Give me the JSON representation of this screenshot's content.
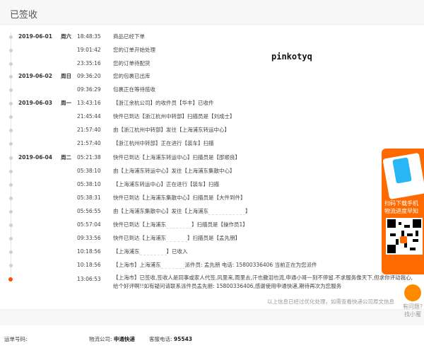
{
  "header": {
    "title": "已签收"
  },
  "watermark": "pinkotyq",
  "timeline": [
    {
      "date": "2019-06-01",
      "weekday": "周六",
      "time": "18:48:35",
      "desc": "商品已经下单"
    },
    {
      "date": "",
      "weekday": "",
      "time": "19:01:42",
      "desc": "您的订单开始处理"
    },
    {
      "date": "",
      "weekday": "",
      "time": "23:35:16",
      "desc": "您的订单待配货"
    },
    {
      "date": "2019-06-02",
      "weekday": "周日",
      "time": "09:36:20",
      "desc": "您的包裹已出库"
    },
    {
      "date": "",
      "weekday": "",
      "time": "09:36:29",
      "desc": "包裹正在等待揽收"
    },
    {
      "date": "2019-06-03",
      "weekday": "周一",
      "time": "13:43:16",
      "desc": "【浙江余杭公司】的收件员【华丰】已收件"
    },
    {
      "date": "",
      "weekday": "",
      "time": "21:45:44",
      "desc": "快件已到达【浙江杭州中转部】扫描员是【刘成士】"
    },
    {
      "date": "",
      "weekday": "",
      "time": "21:57:40",
      "desc": "由【浙江杭州中转部】发往【上海浦东转运中心】"
    },
    {
      "date": "",
      "weekday": "",
      "time": "21:57:40",
      "desc": "【浙江杭州中转部】正在进行【装车】扫描"
    },
    {
      "date": "2019-06-04",
      "weekday": "周二",
      "time": "05:21:38",
      "desc": "快件已到达【上海浦东转运中心】扫描员是【邵顺良】"
    },
    {
      "date": "",
      "weekday": "",
      "time": "05:38:10",
      "desc": "由【上海浦东转运中心】发往【上海浦东集散中心】"
    },
    {
      "date": "",
      "weekday": "",
      "time": "05:38:10",
      "desc": "【上海浦东转运中心】正在进行【装车】扫描"
    },
    {
      "date": "",
      "weekday": "",
      "time": "05:38:31",
      "desc": "快件已到达【上海浦东集散中心】扫描员是【大件到件】"
    },
    {
      "date": "",
      "weekday": "",
      "time": "05:56:55",
      "desc": "由【上海浦东集散中心】发往【上海浦东"
    },
    {
      "date": "",
      "weekday": "",
      "time": "05:57:04",
      "desc": "快件已到达【上海浦东"
    },
    {
      "date": "",
      "weekday": "",
      "time": "09:33:56",
      "desc": "快件已到达【上海浦东"
    },
    {
      "date": "",
      "weekday": "",
      "time": "10:18:56",
      "desc": "【上海浦东"
    },
    {
      "date": "",
      "weekday": "",
      "time": "10:18:56",
      "desc": "【上海市】上海浦东"
    },
    {
      "date": "",
      "weekday": "",
      "time": "13:06:53",
      "desc": "【上海市】已签收,签收人是同事或家人代签,风里来,雨里去,汗也撒泪也流,申通小哥一刻不停留.不求服务像天下,但求你评动我心,给个好评啊!!如有疑问请联系派件员孟先朋: 15800336406,感谢使用申通快递,期待再次为您服务"
    }
  ],
  "masked_tails": {
    "r13": "】",
    "r14": "】扫描员是【操作员1】",
    "r15": "】扫描员是【孟先朋】",
    "r16": "】已收入",
    "r17": "派件员: 孟先朋 电话: 15800336406 当前正在为您派件"
  },
  "footnote": "以上信息已经过优化处理，如需查看快递公司原文信息",
  "bottom": {
    "waybill_label": "运单号码:",
    "company_label": "物流公司:",
    "company": "申通快递",
    "phone_label": "客服电话:",
    "phone": "95543"
  },
  "promo": {
    "line1": "扫码下载手机",
    "line2": "物流进度早知"
  },
  "help": {
    "line1": "有问题?",
    "line2": "找小蜜"
  },
  "colors": {
    "accent": "#ff6a00",
    "active_dot": "#ff4f00"
  }
}
